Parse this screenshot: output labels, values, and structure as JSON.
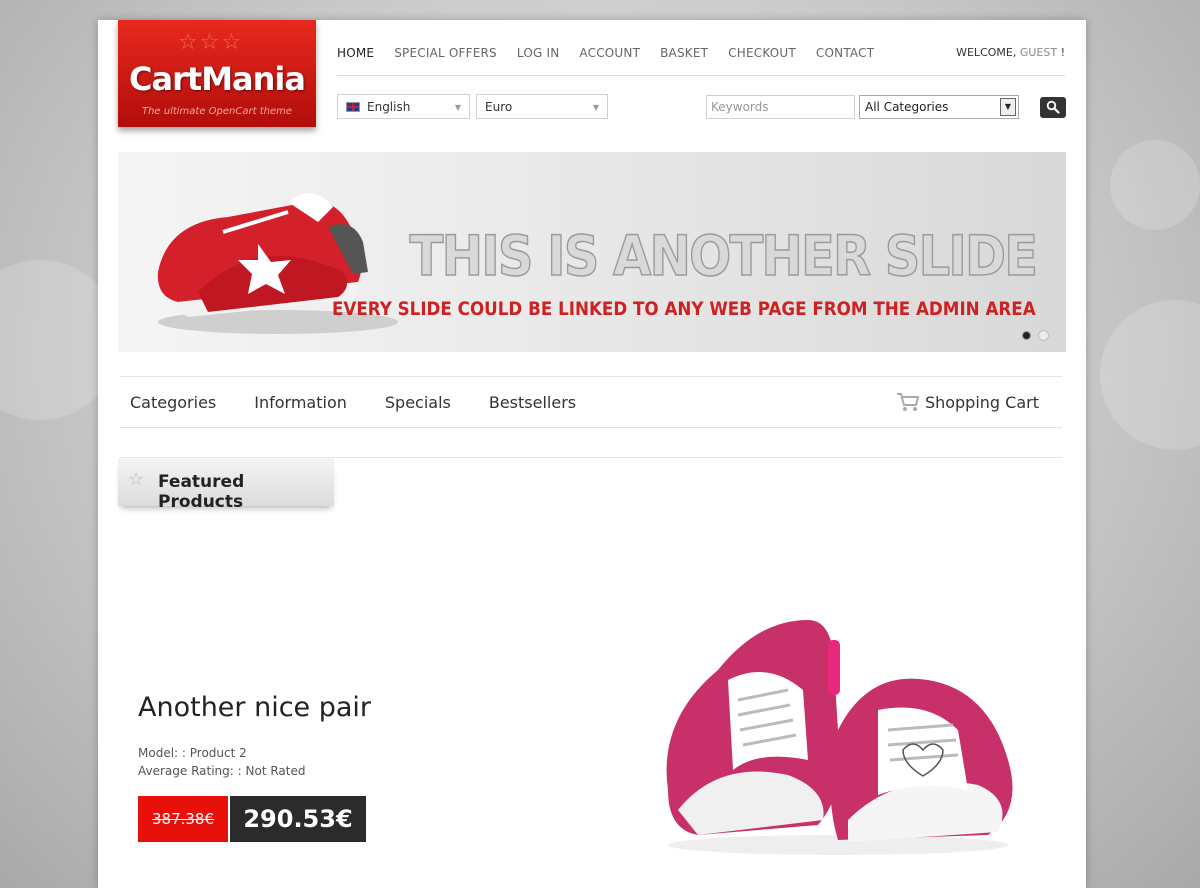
{
  "logo": {
    "brand": "CartMania",
    "tagline": "The ultimate OpenCart theme"
  },
  "topnav": {
    "items": [
      "HOME",
      "SPECIAL OFFERS",
      "LOG IN",
      "ACCOUNT",
      "BASKET",
      "CHECKOUT",
      "CONTACT"
    ],
    "active": "HOME"
  },
  "welcome": {
    "prefix": "WELCOME,",
    "user": "GUEST",
    "suffix": "!"
  },
  "language": {
    "selected": "English",
    "icon": "uk-flag-icon"
  },
  "currency": {
    "selected": "Euro"
  },
  "search": {
    "placeholder": "Keywords",
    "category": "All Categories",
    "button_icon": "magnifier-icon"
  },
  "slider": {
    "title": "THIS IS ANOTHER SLIDE",
    "subtitle": "EVERY SLIDE COULD BE LINKED TO ANY WEB PAGE FROM THE ADMIN AREA",
    "active_dot": 1,
    "dot_count": 2
  },
  "mainnav": {
    "items": [
      "Categories",
      "Information",
      "Specials",
      "Bestsellers"
    ],
    "cart": "Shopping Cart"
  },
  "featured": {
    "title": "Featured Products"
  },
  "product": {
    "name": "Another nice pair",
    "model": "Model: : Product 2",
    "rating": "Average Rating: : Not Rated",
    "old_price": "387.38€",
    "new_price": "290.53€"
  },
  "colors": {
    "brand_red": "#e8291e",
    "price_red": "#e8100a",
    "price_dark": "#2b2b2b",
    "slide_red": "#cc2222"
  }
}
